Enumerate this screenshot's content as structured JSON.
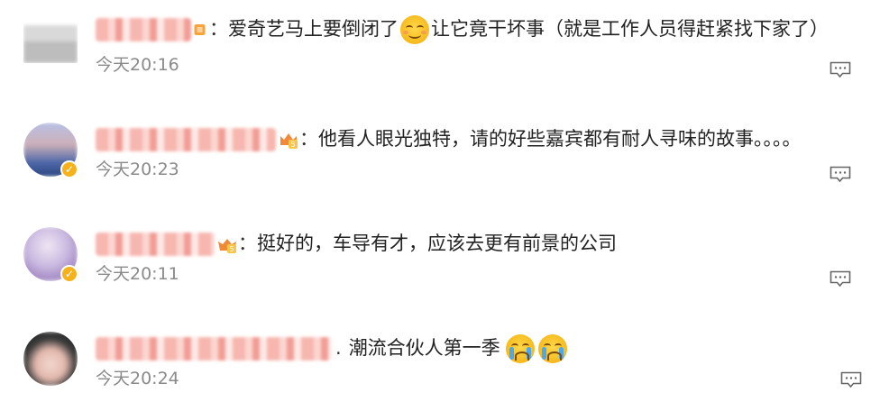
{
  "comments": [
    {
      "separator": "：",
      "text": "爱奇艺马上要倒闭了",
      "text_after_emoji": "让它竟干坏事（就是工作人员得赶紧找下家了）",
      "emoji": "smile-emoji",
      "time": "今天20:16",
      "avatar_colors": [
        "#e9e9e9",
        "#cfcfcf"
      ],
      "verified": false,
      "badge": "vip-badge"
    },
    {
      "separator": "：",
      "text": "他看人眼光独特，请的好些嘉宾都有耐人寻味的故事。。。。",
      "time": "今天20:23",
      "avatar_colors": [
        "#9aa5d6",
        "#c9b0b8",
        "#3e5a9a"
      ],
      "verified": true,
      "badge": "crown-badge"
    },
    {
      "separator": "：",
      "text": "挺好的，车导有才，应该去更有前景的公司",
      "time": "今天20:11",
      "avatar_colors": [
        "#d8d0ea",
        "#b9a6d4",
        "#e8dfe0"
      ],
      "verified": true,
      "badge": "crown-badge"
    },
    {
      "separator": ".",
      "text": "潮流合伙人第一季",
      "emoji": "crying-emoji",
      "time": "今天20:24",
      "avatar_colors": [
        "#3b3b3b",
        "#e7c8c0",
        "#2a2a2a"
      ],
      "verified": false,
      "badge": ""
    }
  ],
  "colors": {
    "username": "#f29d96",
    "time": "#8a8a8a",
    "text": "#222222",
    "verified": "#f5b21c"
  }
}
